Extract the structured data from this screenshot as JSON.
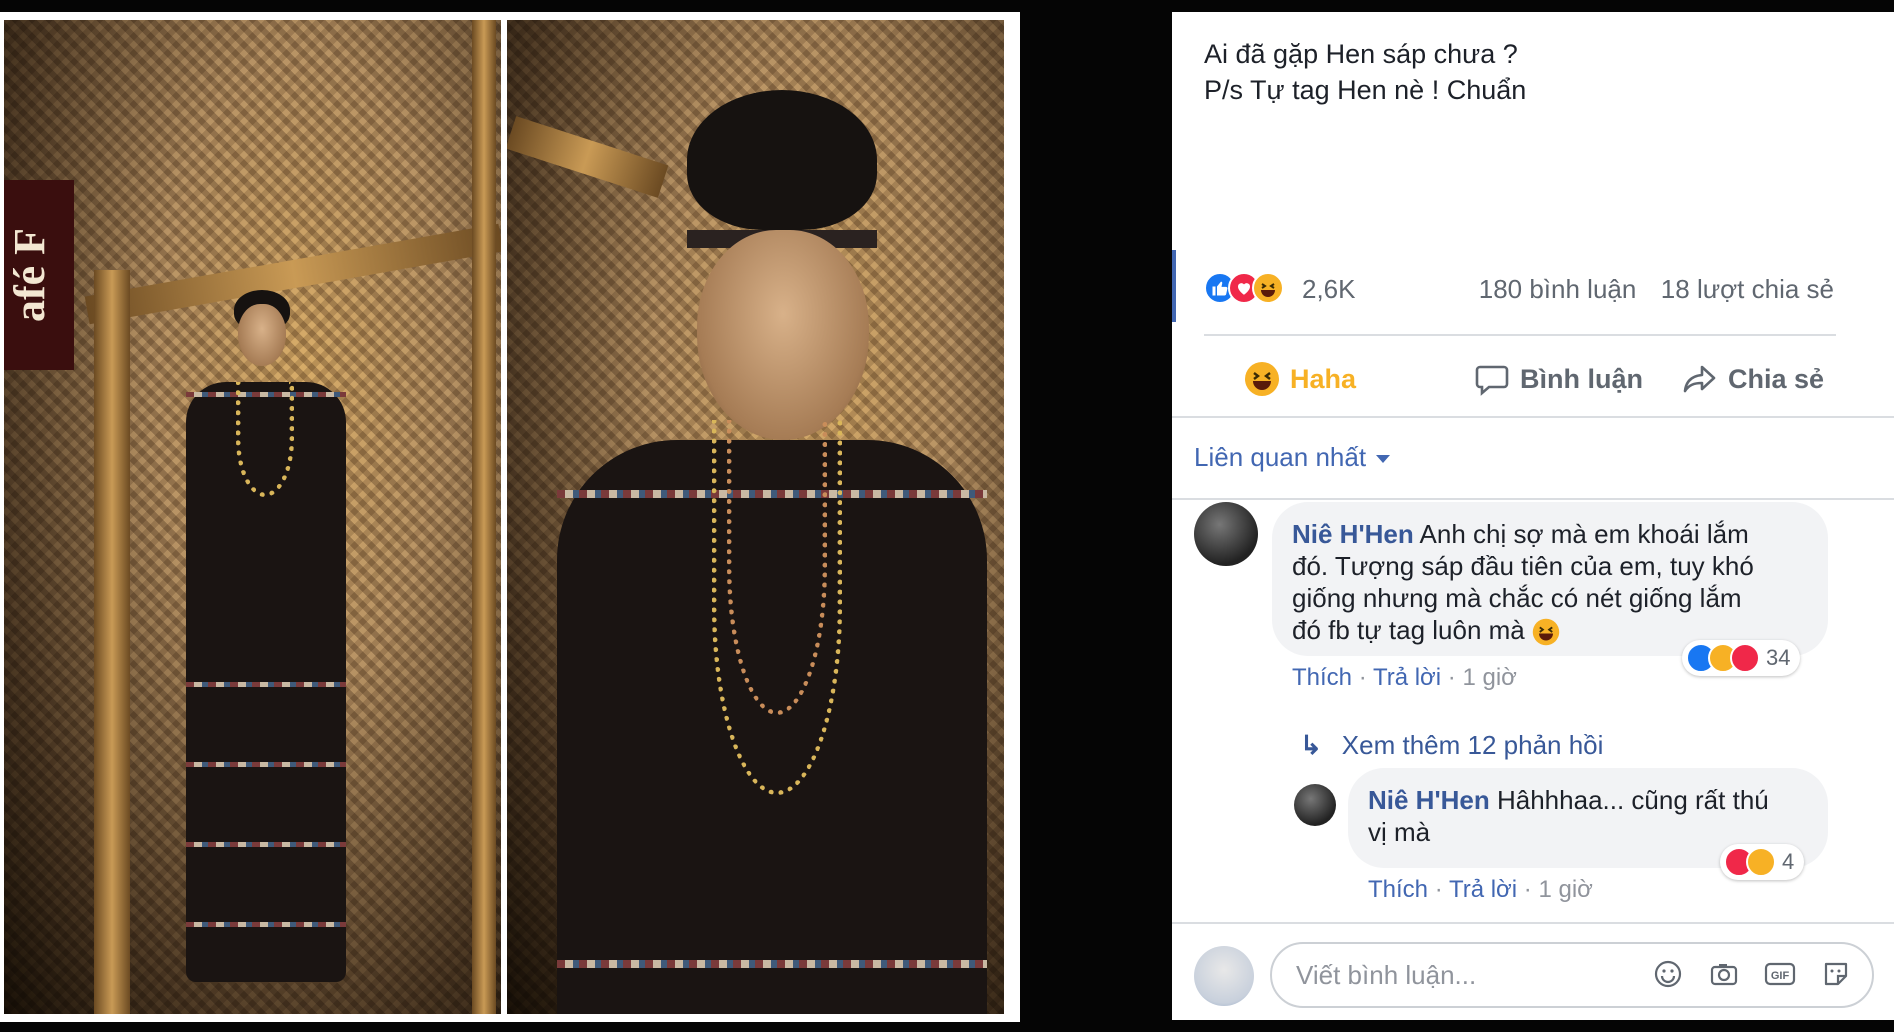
{
  "post": {
    "text_line1": "Ai đã gặp Hen sáp chưa ?",
    "text_line2": "P/s Tự tag Hen nè ! Chuẩn"
  },
  "reactions": {
    "icons": [
      "like-icon",
      "love-icon",
      "haha-icon"
    ],
    "count": "2,6K",
    "comments": "180 bình luận",
    "shares": "18 lượt chia sẻ"
  },
  "actions": {
    "haha_label": "Haha",
    "comment_label": "Bình luận",
    "share_label": "Chia sẻ"
  },
  "sort": {
    "label": "Liên quan nhất"
  },
  "comments": [
    {
      "author": "Niê H'Hen",
      "text_line1": " Anh chị sợ mà em khoái lắm",
      "text_line2": "đó. Tượng sáp đầu tiên của em, tuy khó",
      "text_line3": "giống nhưng mà chắc có nét giống lắm",
      "text_line4": "đó fb tự tag luôn mà ",
      "like": "Thích",
      "reply": "Trả lời",
      "time": "1 giờ",
      "reaction_count": "34"
    }
  ],
  "more_replies": "Xem thêm 12 phản hồi",
  "reply": {
    "author": "Niê H'Hen",
    "text_line1": " Hâhhhaa... cũng rất thú",
    "text_line2": "vị mà",
    "like": "Thích",
    "reply": "Trả lời",
    "time": "1 giờ",
    "reaction_count": "4"
  },
  "composer": {
    "placeholder": "Viết bình luận...",
    "icons": [
      "emoji-icon",
      "camera-icon",
      "gif-icon",
      "sticker-icon"
    ]
  },
  "photo": {
    "sign_text": "afé F"
  },
  "colors": {
    "link": "#385898",
    "accent": "#4267b2",
    "haha": "#f7b125",
    "love": "#f02849",
    "like": "#1877f2"
  }
}
